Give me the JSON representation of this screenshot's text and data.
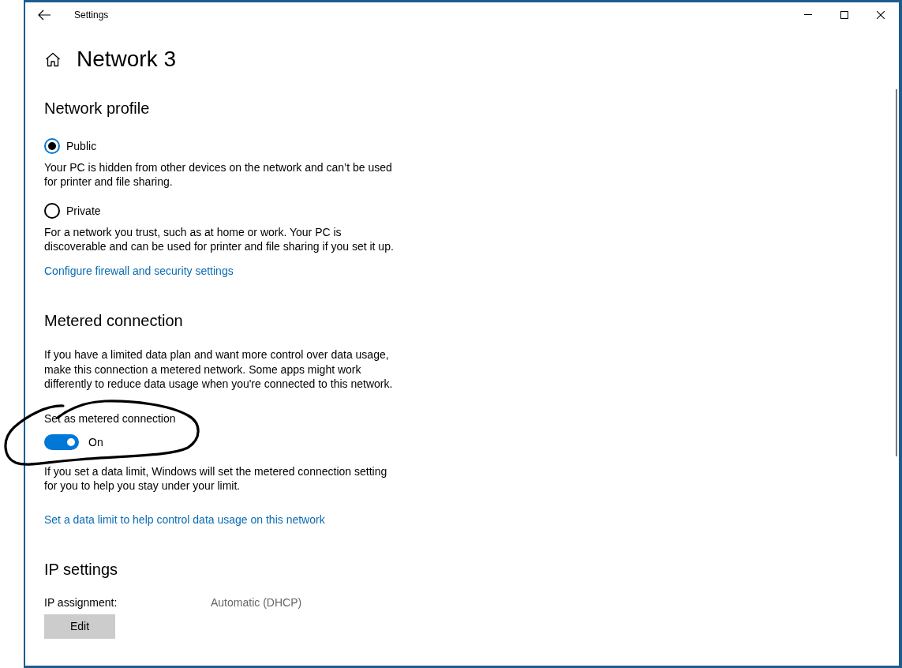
{
  "window": {
    "title": "Settings"
  },
  "page": {
    "title": "Network 3"
  },
  "network_profile": {
    "heading": "Network profile",
    "options": [
      {
        "label": "Public",
        "selected": true,
        "description": "Your PC is hidden from other devices on the network and can’t be used for printer and file sharing."
      },
      {
        "label": "Private",
        "selected": false,
        "description": "For a network you trust, such as at home or work. Your PC is discoverable and can be used for printer and file sharing if you set it up."
      }
    ],
    "link": "Configure firewall and security settings"
  },
  "metered_connection": {
    "heading": "Metered connection",
    "description": "If you have a limited data plan and want more control over data usage, make this connection a metered network. Some apps might work differently to reduce data usage when you're connected to this network.",
    "toggle": {
      "label": "Set as metered connection",
      "on": true,
      "state_text": "On",
      "circled": true
    },
    "note": "If you set a data limit, Windows will set the metered connection setting for you to help you stay under your limit.",
    "link": "Set a data limit to help control data usage on this network"
  },
  "ip_settings": {
    "heading": "IP settings",
    "fields": [
      {
        "label": "IP assignment:",
        "value": "Automatic (DHCP)"
      }
    ],
    "button": "Edit"
  }
}
